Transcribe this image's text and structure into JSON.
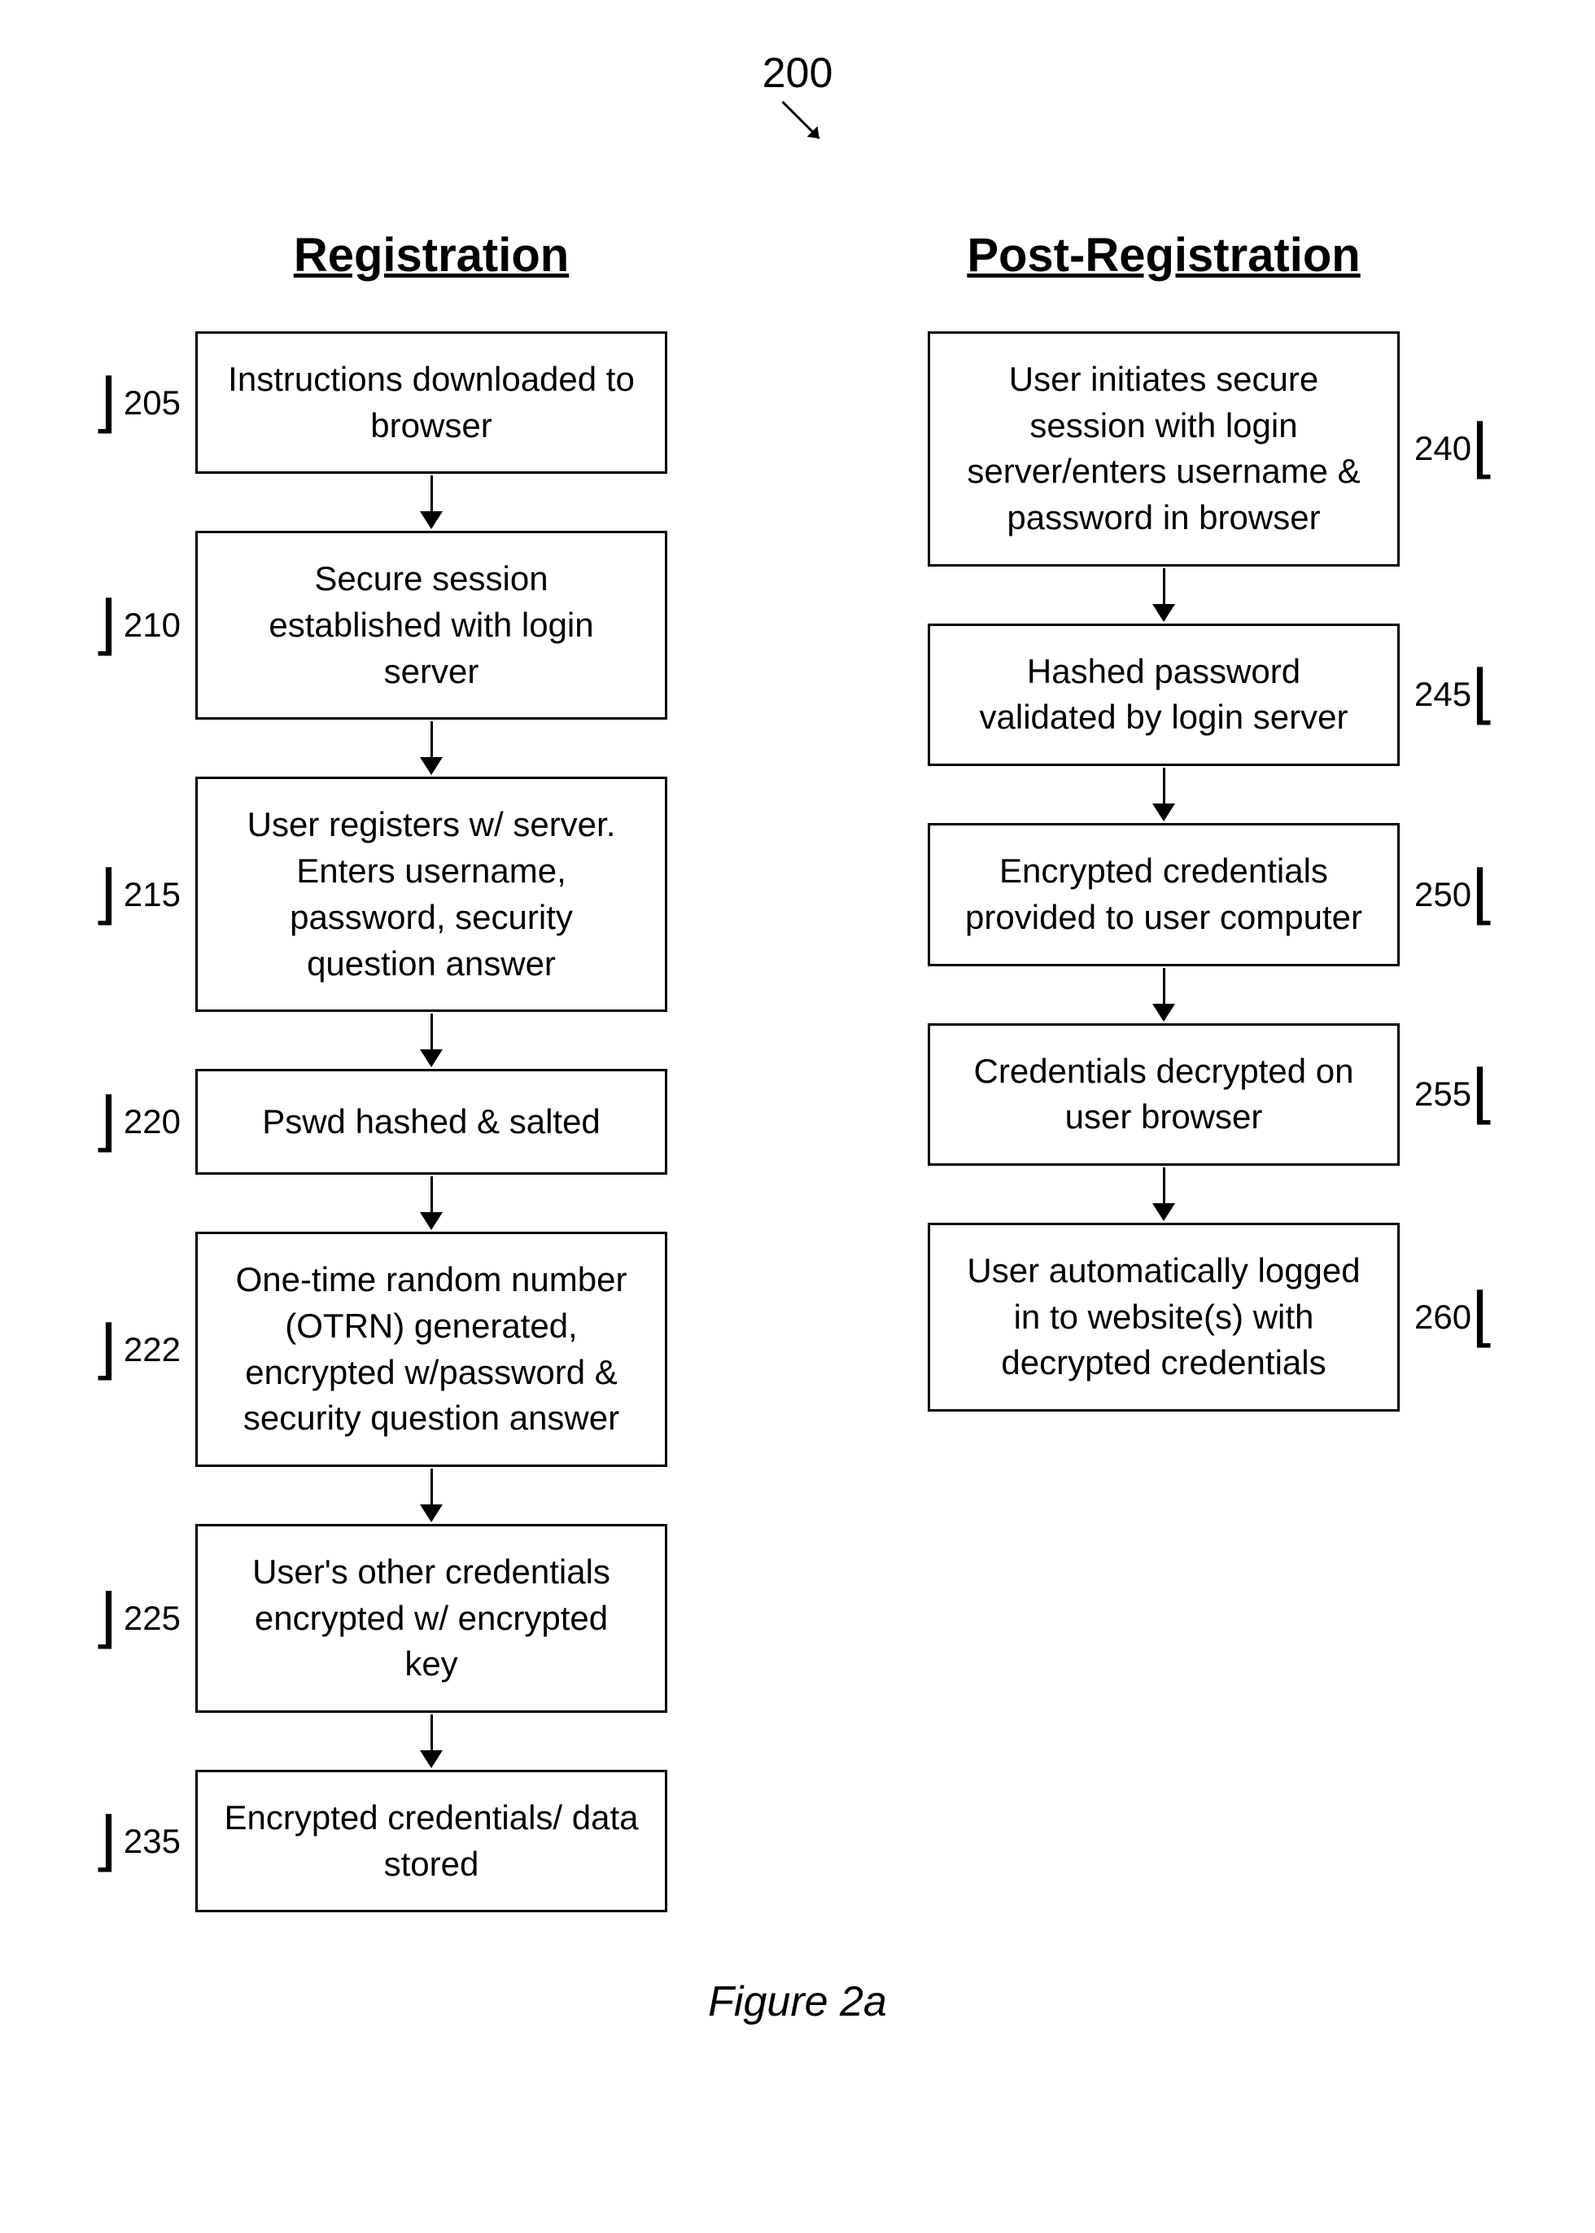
{
  "figure": {
    "number": "200",
    "caption": "Figure 2a"
  },
  "registration": {
    "title": "Registration",
    "steps": [
      {
        "id": "205",
        "label_side": "left",
        "text": "Instructions downloaded to browser"
      },
      {
        "id": "210",
        "label_side": "left",
        "text": "Secure session established with login server"
      },
      {
        "id": "215",
        "label_side": "left",
        "text": "User registers w/ server. Enters username, password, security question answer"
      },
      {
        "id": "220",
        "label_side": "left",
        "text": "Pswd hashed & salted"
      },
      {
        "id": "222",
        "label_side": "left",
        "text": "One-time random number (OTRN) generated, encrypted w/password & security question answer"
      },
      {
        "id": "225",
        "label_side": "left",
        "text": "User's other credentials encrypted w/ encrypted key"
      },
      {
        "id": "235",
        "label_side": "left",
        "text": "Encrypted credentials/ data stored"
      }
    ]
  },
  "post_registration": {
    "title": "Post-Registration",
    "steps": [
      {
        "id": "240",
        "label_side": "right",
        "text": "User initiates secure session with login server/enters username & password in browser"
      },
      {
        "id": "245",
        "label_side": "right",
        "text": "Hashed password validated by login server"
      },
      {
        "id": "250",
        "label_side": "right",
        "text": "Encrypted credentials provided to user computer"
      },
      {
        "id": "255",
        "label_side": "right",
        "text": "Credentials decrypted on user browser"
      },
      {
        "id": "260",
        "label_side": "right",
        "text": "User automatically logged in to website(s) with decrypted credentials"
      }
    ]
  }
}
